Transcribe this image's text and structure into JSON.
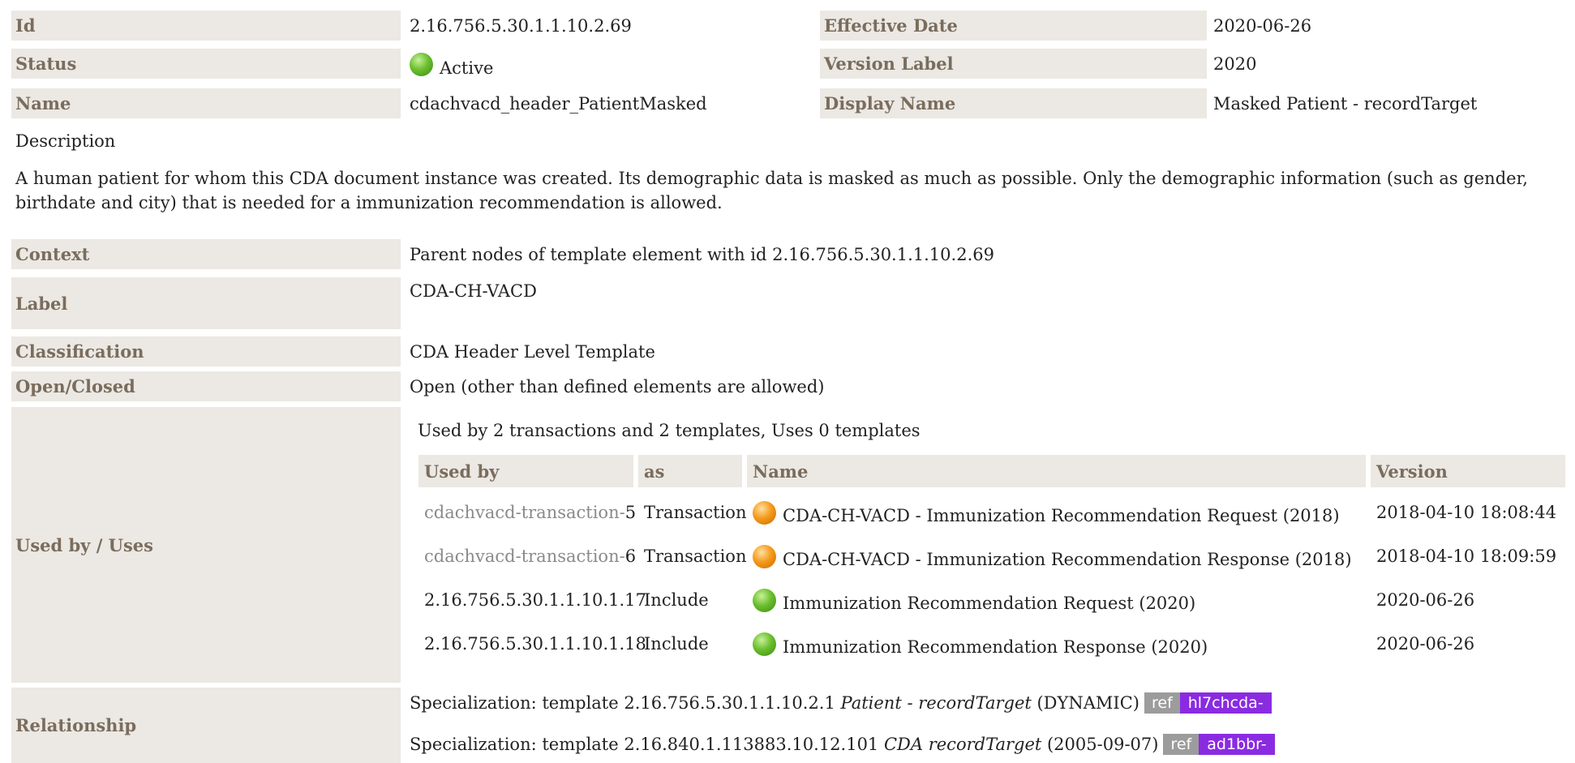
{
  "header": {
    "id_label": "Id",
    "id_value": "2.16.756.5.30.1.1.10.2.69",
    "effective_label": "Effective Date",
    "effective_value": "2020-06-26",
    "status_label": "Status",
    "status_value": "Active",
    "version_label_label": "Version Label",
    "version_label_value": "2020",
    "name_label": "Name",
    "name_value": "cdachvacd_header_PatientMasked",
    "display_label": "Display Name",
    "display_value": "Masked Patient - recordTarget"
  },
  "description": {
    "heading": "Description",
    "text": "A human patient for whom this CDA document instance was created. Its demographic data is masked as much as possible. Only the demographic information (such as gender, birthdate and city) that is needed for a immunization recommendation is allowed."
  },
  "details": {
    "context_label": "Context",
    "context_value": "Parent nodes of template element with id 2.16.756.5.30.1.1.10.2.69",
    "label_label": "Label",
    "label_value": "CDA-CH-VACD",
    "classification_label": "Classification",
    "classification_value": "CDA Header Level Template",
    "open_label": "Open/Closed",
    "open_value": "Open (other than defined elements are allowed)",
    "usedby_label": "Used by / Uses",
    "relationship_label": "Relationship"
  },
  "usage": {
    "summary": "Used by 2 transactions and 2 templates, Uses 0 templates",
    "columns": [
      "Used by",
      "as",
      "Name",
      "Version"
    ],
    "rows": [
      {
        "prefix": "cdachvacd-transaction-",
        "num": "5",
        "as": "Transaction",
        "status": "orange",
        "name": "CDA-CH-VACD - Immunization Recommendation Request (2018)",
        "version": "2018-04-10 18:08:44"
      },
      {
        "prefix": "cdachvacd-transaction-",
        "num": "6",
        "as": "Transaction",
        "status": "orange",
        "name": "CDA-CH-VACD - Immunization Recommendation Response (2018)",
        "version": "2018-04-10 18:09:59"
      },
      {
        "prefix": "",
        "num": "2.16.756.5.30.1.1.10.1.17",
        "as": "Include",
        "status": "green",
        "name": "Immunization Recommendation Request (2020)",
        "version": "2020-06-26"
      },
      {
        "prefix": "",
        "num": "2.16.756.5.30.1.1.10.1.18",
        "as": "Include",
        "status": "green",
        "name": "Immunization Recommendation Response (2020)",
        "version": "2020-06-26"
      }
    ]
  },
  "relationships": [
    {
      "pre": "Specialization: template 2.16.756.5.30.1.1.10.2.1 ",
      "italic": "Patient - recordTarget",
      "post": " (DYNAMIC)",
      "ref": "ref",
      "tag": "hl7chcda-"
    },
    {
      "pre": "Specialization: template 2.16.840.1.113883.10.12.101 ",
      "italic": "CDA recordTarget",
      "post": " (2005-09-07)",
      "ref": "ref",
      "tag": "ad1bbr-"
    }
  ]
}
